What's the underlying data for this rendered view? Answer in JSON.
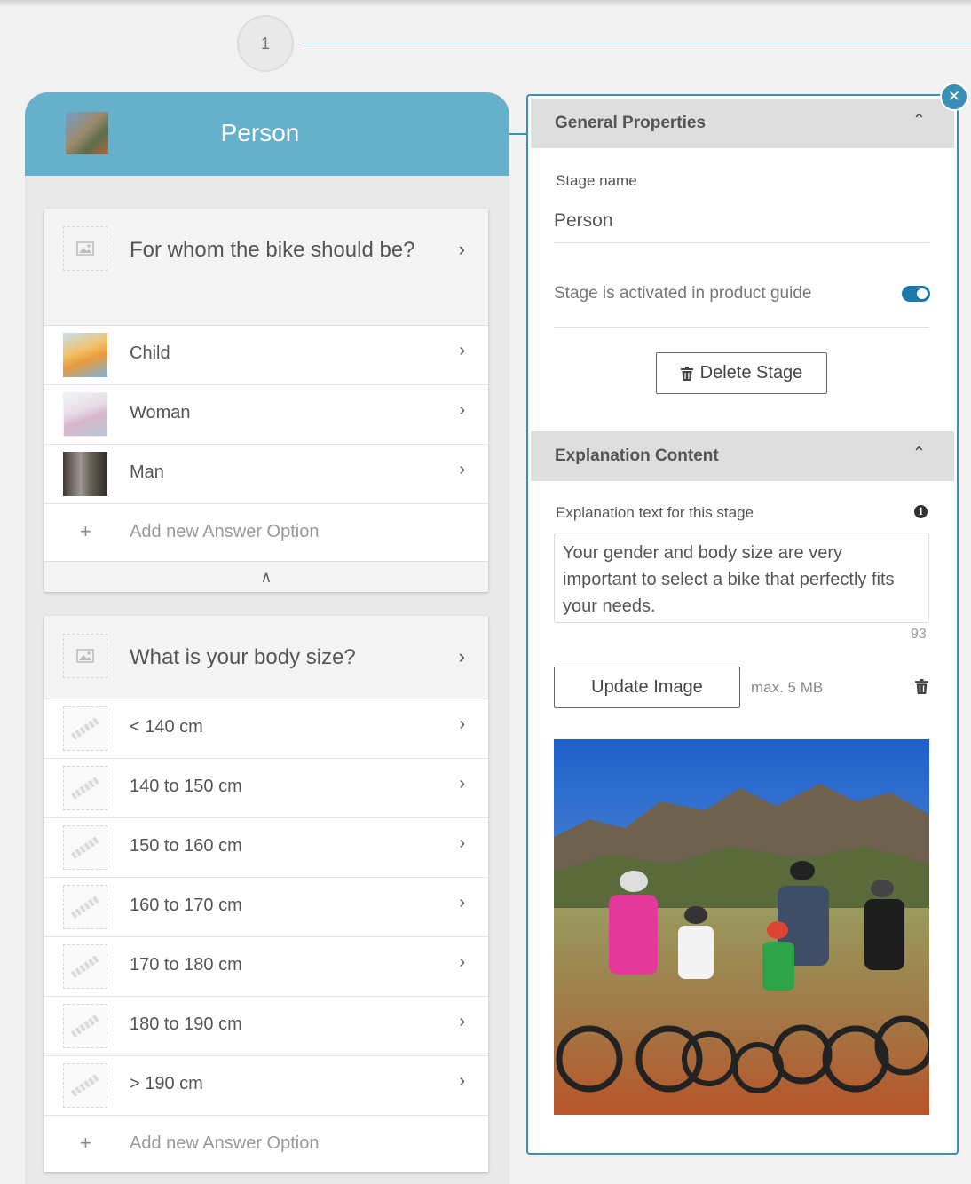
{
  "stage": {
    "number": "1",
    "title": "Person"
  },
  "questions": [
    {
      "title": "For whom the bike should be?",
      "answers": [
        {
          "label": "Child"
        },
        {
          "label": "Woman"
        },
        {
          "label": "Man"
        }
      ],
      "add_label": "Add new Answer Option",
      "collapse_icon": "double-chevron-up-icon"
    },
    {
      "title": "What is your body size?",
      "answers": [
        {
          "label": "< 140 cm"
        },
        {
          "label": "140 to 150 cm"
        },
        {
          "label": "150 to 160 cm"
        },
        {
          "label": "160 to 170 cm"
        },
        {
          "label": "170 to 180 cm"
        },
        {
          "label": "180 to 190 cm"
        },
        {
          "label": "> 190 cm"
        }
      ],
      "add_label": "Add new Answer Option"
    }
  ],
  "panel": {
    "general": {
      "title": "General Properties",
      "stage_name_label": "Stage name",
      "stage_name_value": "Person",
      "activated_label": "Stage is activated in product guide",
      "activated": true,
      "delete_label": "Delete Stage"
    },
    "explanation": {
      "title": "Explanation Content",
      "text_label": "Explanation text for this stage",
      "text_value": "Your gender and body size are very important to select a bike that perfectly fits your needs.",
      "char_count": "93",
      "update_image_label": "Update Image",
      "max_size_label": "max. 5 MB"
    }
  },
  "colors": {
    "accent": "#3a8fb7",
    "header": "#67b0cc",
    "toggle_on": "#1e78a8"
  }
}
